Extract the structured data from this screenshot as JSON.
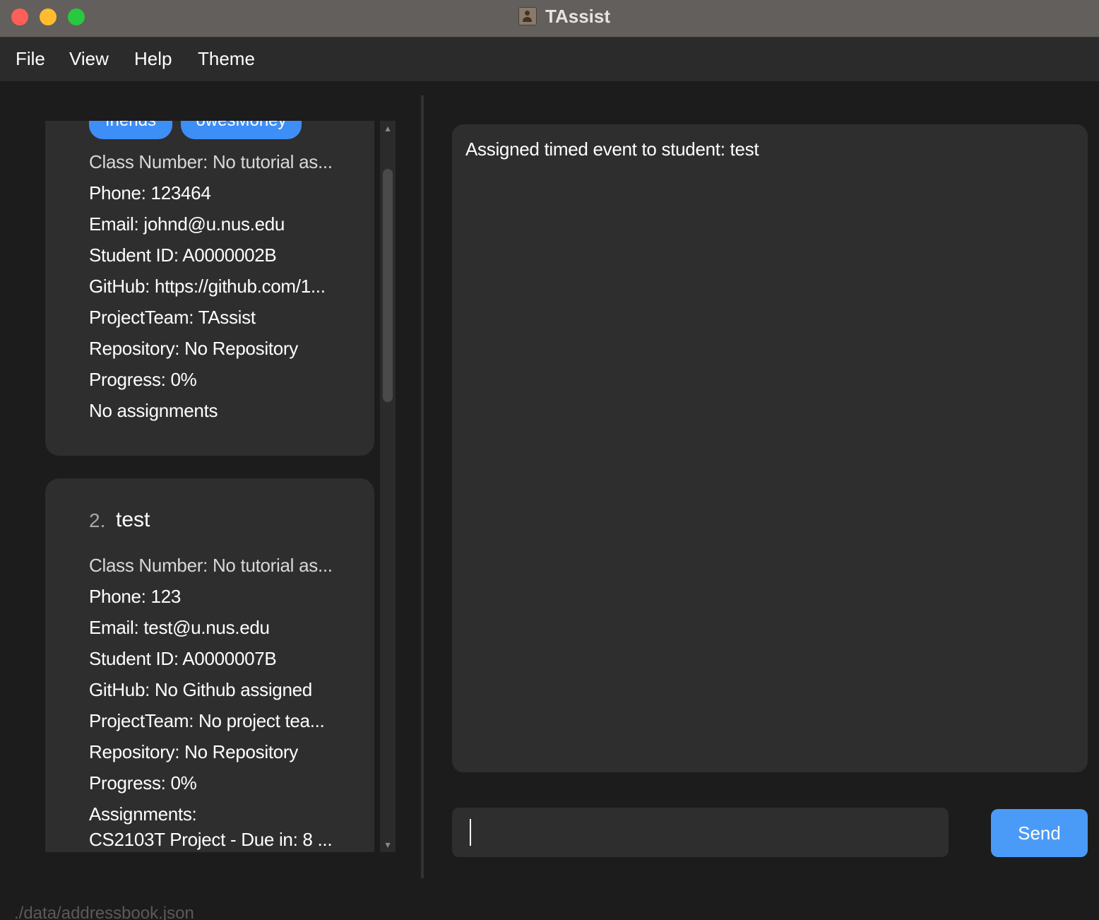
{
  "window": {
    "title": "TAssist"
  },
  "menu": {
    "items": [
      "File",
      "View",
      "Help",
      "Theme"
    ]
  },
  "students": [
    {
      "tags": [
        "friends",
        "owesMoney"
      ],
      "class_number": "Class Number: No tutorial as...",
      "phone": "Phone: 123464",
      "email": "Email: johnd@u.nus.edu",
      "student_id": "Student ID: A0000002B",
      "github": "GitHub: https://github.com/1...",
      "project_team": "ProjectTeam: TAssist",
      "repository": "Repository: No Repository",
      "progress": "Progress: 0%",
      "assignments": "No assignments"
    },
    {
      "index": "2.",
      "name": "test",
      "class_number": "Class Number: No tutorial as...",
      "phone": "Phone: 123",
      "email": "Email: test@u.nus.edu",
      "student_id": "Student ID: A0000007B",
      "github": "GitHub: No Github assigned",
      "project_team": "ProjectTeam: No project tea...",
      "repository": "Repository: No Repository",
      "progress": "Progress: 0%",
      "assignments_label": "Assignments:",
      "assignments": "CS2103T Project - Due in: 8 ..."
    }
  ],
  "result": {
    "message": "Assigned timed event to student: test"
  },
  "command": {
    "value": "",
    "send_label": "Send"
  },
  "status": {
    "file_path": "./data/addressbook.json"
  },
  "colors": {
    "accent": "#4a9bf7",
    "tag": "#3e8ef7",
    "card": "#2e2e2e",
    "background": "#1c1c1c"
  }
}
